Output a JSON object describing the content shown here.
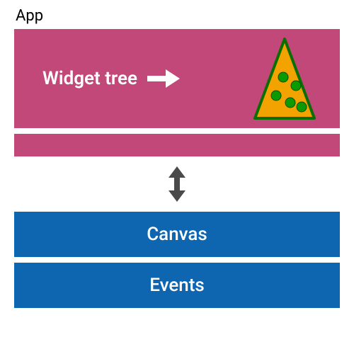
{
  "app_label": "App",
  "widget_tree": {
    "label": "Widget tree"
  },
  "canvas": {
    "label": "Canvas"
  },
  "events": {
    "label": "Events"
  },
  "icons": {
    "arrow_right": "arrow-right-icon",
    "bidirectional": "bidirectional-arrow-icon",
    "pizza": "pizza-slice-icon"
  },
  "colors": {
    "pink": "#C3487A",
    "blue": "#0D66AF",
    "triangle_fill": "#F2A300",
    "triangle_stroke": "#0B6E00",
    "dot": "#0B9A00",
    "arrow_gray": "#4A4A4A"
  }
}
